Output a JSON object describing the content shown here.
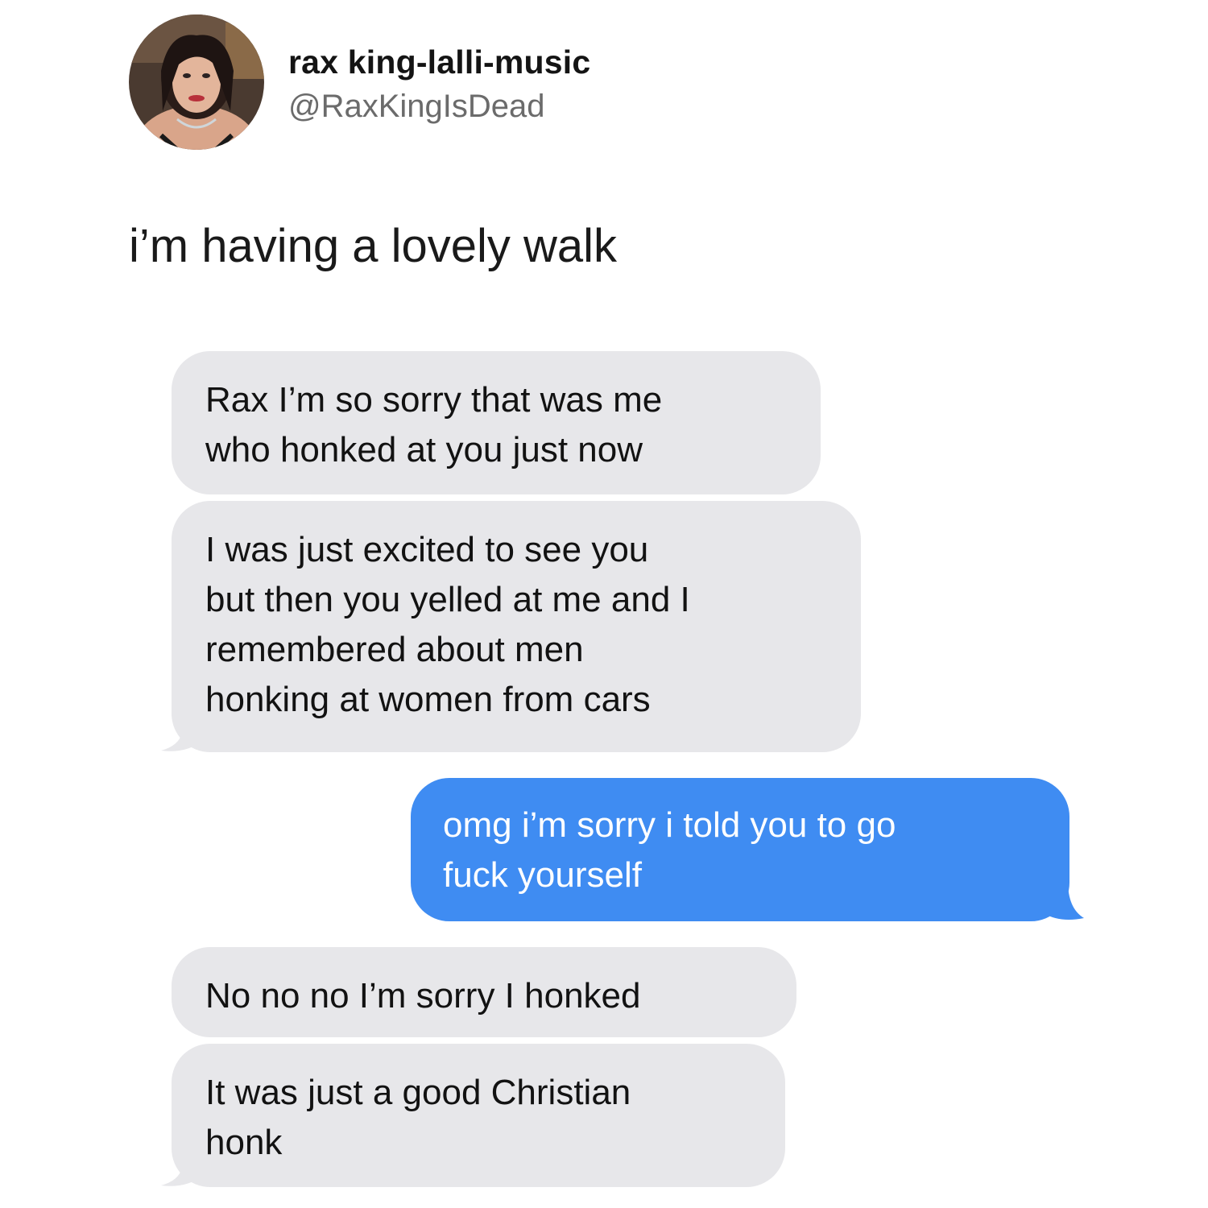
{
  "tweet": {
    "display_name": "rax king-lalli-music",
    "handle": "@RaxKingIsDead",
    "text": "i’m having a lovely walk"
  },
  "avatar": {
    "icon": "profile-photo"
  },
  "messages": [
    {
      "sender": "other",
      "text": "Rax I’m so sorry that was me\nwho honked at you just now"
    },
    {
      "sender": "other",
      "text": "I was just excited to see you\nbut then you yelled at me and I\nremembered about men\nhonking at women from cars"
    },
    {
      "sender": "me",
      "text": "omg i’m sorry i told you to go\nfuck yourself"
    },
    {
      "sender": "other",
      "text": "No no no I’m sorry I honked"
    },
    {
      "sender": "other",
      "text": "It was just a good Christian\nhonk"
    }
  ],
  "colors": {
    "received_bubble": "#e7e7ea",
    "sent_bubble": "#3f8cf2"
  }
}
